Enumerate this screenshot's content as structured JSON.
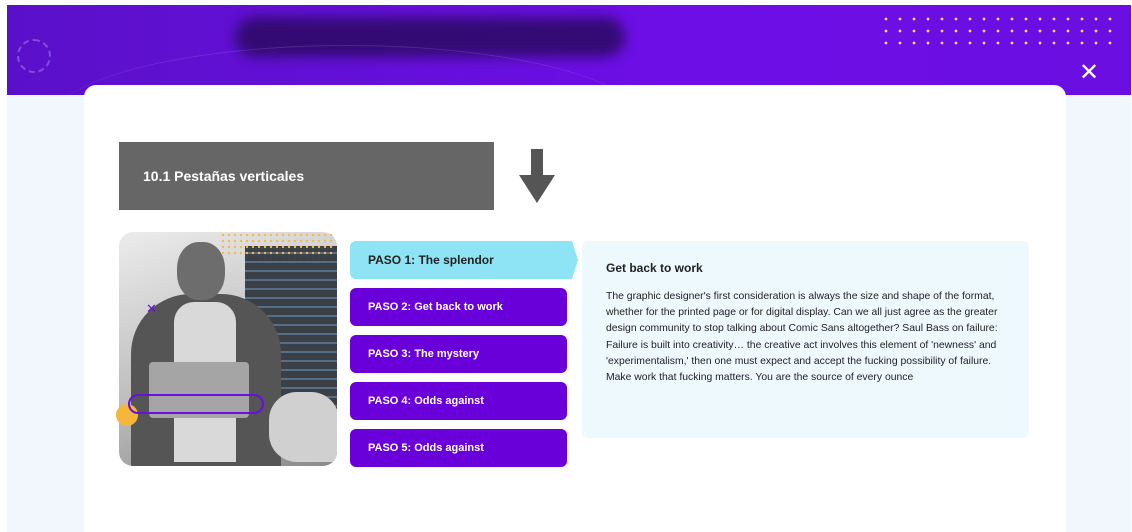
{
  "header": {
    "close_label": "✕"
  },
  "section": {
    "title": "10.1 Pestañas verticales",
    "arrow_icon": "arrow-down-icon"
  },
  "tabs": [
    {
      "label": "PASO 1: The splendor",
      "active": true
    },
    {
      "label": "PASO 2: Get back to work",
      "active": false
    },
    {
      "label": "PASO 3: The mystery",
      "active": false
    },
    {
      "label": "PASO 4: Odds against",
      "active": false
    },
    {
      "label": "PASO 5: Odds against",
      "active": false
    }
  ],
  "content": {
    "title": "Get back to work",
    "body": "The graphic designer's first consideration is always the size and shape of the format, whether for the printed page or for digital display. Can we all just agree as the greater design community to stop talking about Comic Sans altogether? Saul Bass on failure: Failure is built into creativity… the creative act involves this element of 'newness' and 'experimentalism,' then one must expect and accept the fucking possibility of failure. Make work that fucking matters. You are the source of every ounce"
  },
  "colors": {
    "banner": "#6a0ee2",
    "tab": "#6a00d9",
    "tab_active": "#8ee3f5",
    "section_bg": "#666666",
    "panel_bg": "#eef9fd"
  }
}
